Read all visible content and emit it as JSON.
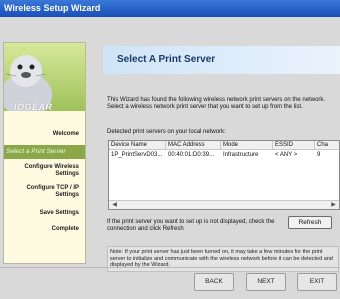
{
  "window": {
    "title": "Wireless Setup Wizard"
  },
  "sidebar": {
    "brand": "IOGEAR",
    "items": [
      {
        "label": "Welcome"
      },
      {
        "label": "Select a Print Server"
      },
      {
        "label": "Configure Wireless Settings"
      },
      {
        "label": "Configure TCP / IP Settings"
      },
      {
        "label": "Save Settings"
      },
      {
        "label": "Complete"
      }
    ]
  },
  "main": {
    "title": "Select A Print Server",
    "intro_line1": "This Wizard has found the following wireless network print servers on the network.",
    "intro_line2": "Select a wireless network print server that you want to set up from the list.",
    "detected_label": "Detected print servers on your local network:",
    "table": {
      "headers": [
        "Device Name",
        "MAC Address",
        "Mode",
        "ESSID",
        "Cha"
      ],
      "rows": [
        [
          "1P_PrintServD03...",
          "00:40:01:D0:39...",
          "Infrastructure",
          "< ANY >",
          "9"
        ]
      ]
    },
    "not_listed_text": "If the print server you want to set up is not displayed, check the connection and click Refresh",
    "refresh_label": "Refresh",
    "note": "Note: If your print server has just been turned on, it may take a few minutes for the print server to initialize and communicate with the wireless network before it can be detected and displayed by the Wizard."
  },
  "footer": {
    "back": "BACK",
    "next": "NEXT",
    "exit": "EXIT"
  },
  "colors": {
    "title_bar": "#1a4fb8",
    "sidebar_active": "#8aa848",
    "sidebar_bg": "#fffbe0",
    "header_band": "#cfe4f7"
  }
}
